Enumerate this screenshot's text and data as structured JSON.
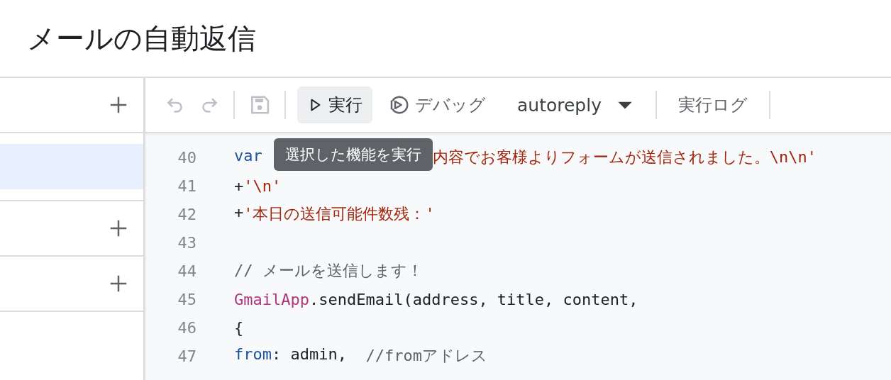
{
  "header": {
    "title": "メールの自動返信"
  },
  "sidebar": {
    "rows": [
      {
        "kind": "section"
      },
      {
        "kind": "item",
        "selected": true
      },
      {
        "kind": "section"
      },
      {
        "kind": "section"
      }
    ]
  },
  "toolbar": {
    "undo": {
      "disabled": true
    },
    "redo": {
      "disabled": true
    },
    "save": {
      "disabled": true
    },
    "run": {
      "label": "実行",
      "hovered": true
    },
    "debug": {
      "label": "デバッグ"
    },
    "function_select": {
      "value": "autoreply"
    },
    "log": {
      "label": "実行ログ"
    }
  },
  "tooltip": {
    "text": "選択した機能を実行"
  },
  "editor": {
    "lines": [
      {
        "number": "40",
        "tokens": [
          {
            "kind": "keyword",
            "text": "var"
          },
          {
            "kind": "hidden"
          },
          {
            "kind": "string",
            "text": "内容でお客様よりフォームが送信されました。\\n\\n'"
          }
        ]
      },
      {
        "number": "41",
        "tokens": [
          {
            "kind": "plain",
            "text": "+"
          },
          {
            "kind": "string",
            "text": "'\\n'"
          }
        ]
      },
      {
        "number": "42",
        "tokens": [
          {
            "kind": "plain",
            "text": "+"
          },
          {
            "kind": "string",
            "text": "'本日の送信可能件数残：'"
          }
        ]
      },
      {
        "number": "43"
      },
      {
        "number": "44",
        "tokens": [
          {
            "kind": "comment",
            "text": "// メールを送信します！"
          }
        ]
      },
      {
        "number": "45",
        "tokens": [
          {
            "kind": "class",
            "text": "GmailApp"
          },
          {
            "kind": "plain",
            "text": ".sendEmail(address, title, content,"
          }
        ]
      },
      {
        "number": "46",
        "tokens": [
          {
            "kind": "plain",
            "text": "{"
          }
        ]
      },
      {
        "number": "47",
        "tokens": [
          {
            "kind": "keyword",
            "text": "from"
          },
          {
            "kind": "plain",
            "text": ": admin,  "
          },
          {
            "kind": "comment",
            "text": "//fromアドレス"
          }
        ]
      }
    ]
  }
}
